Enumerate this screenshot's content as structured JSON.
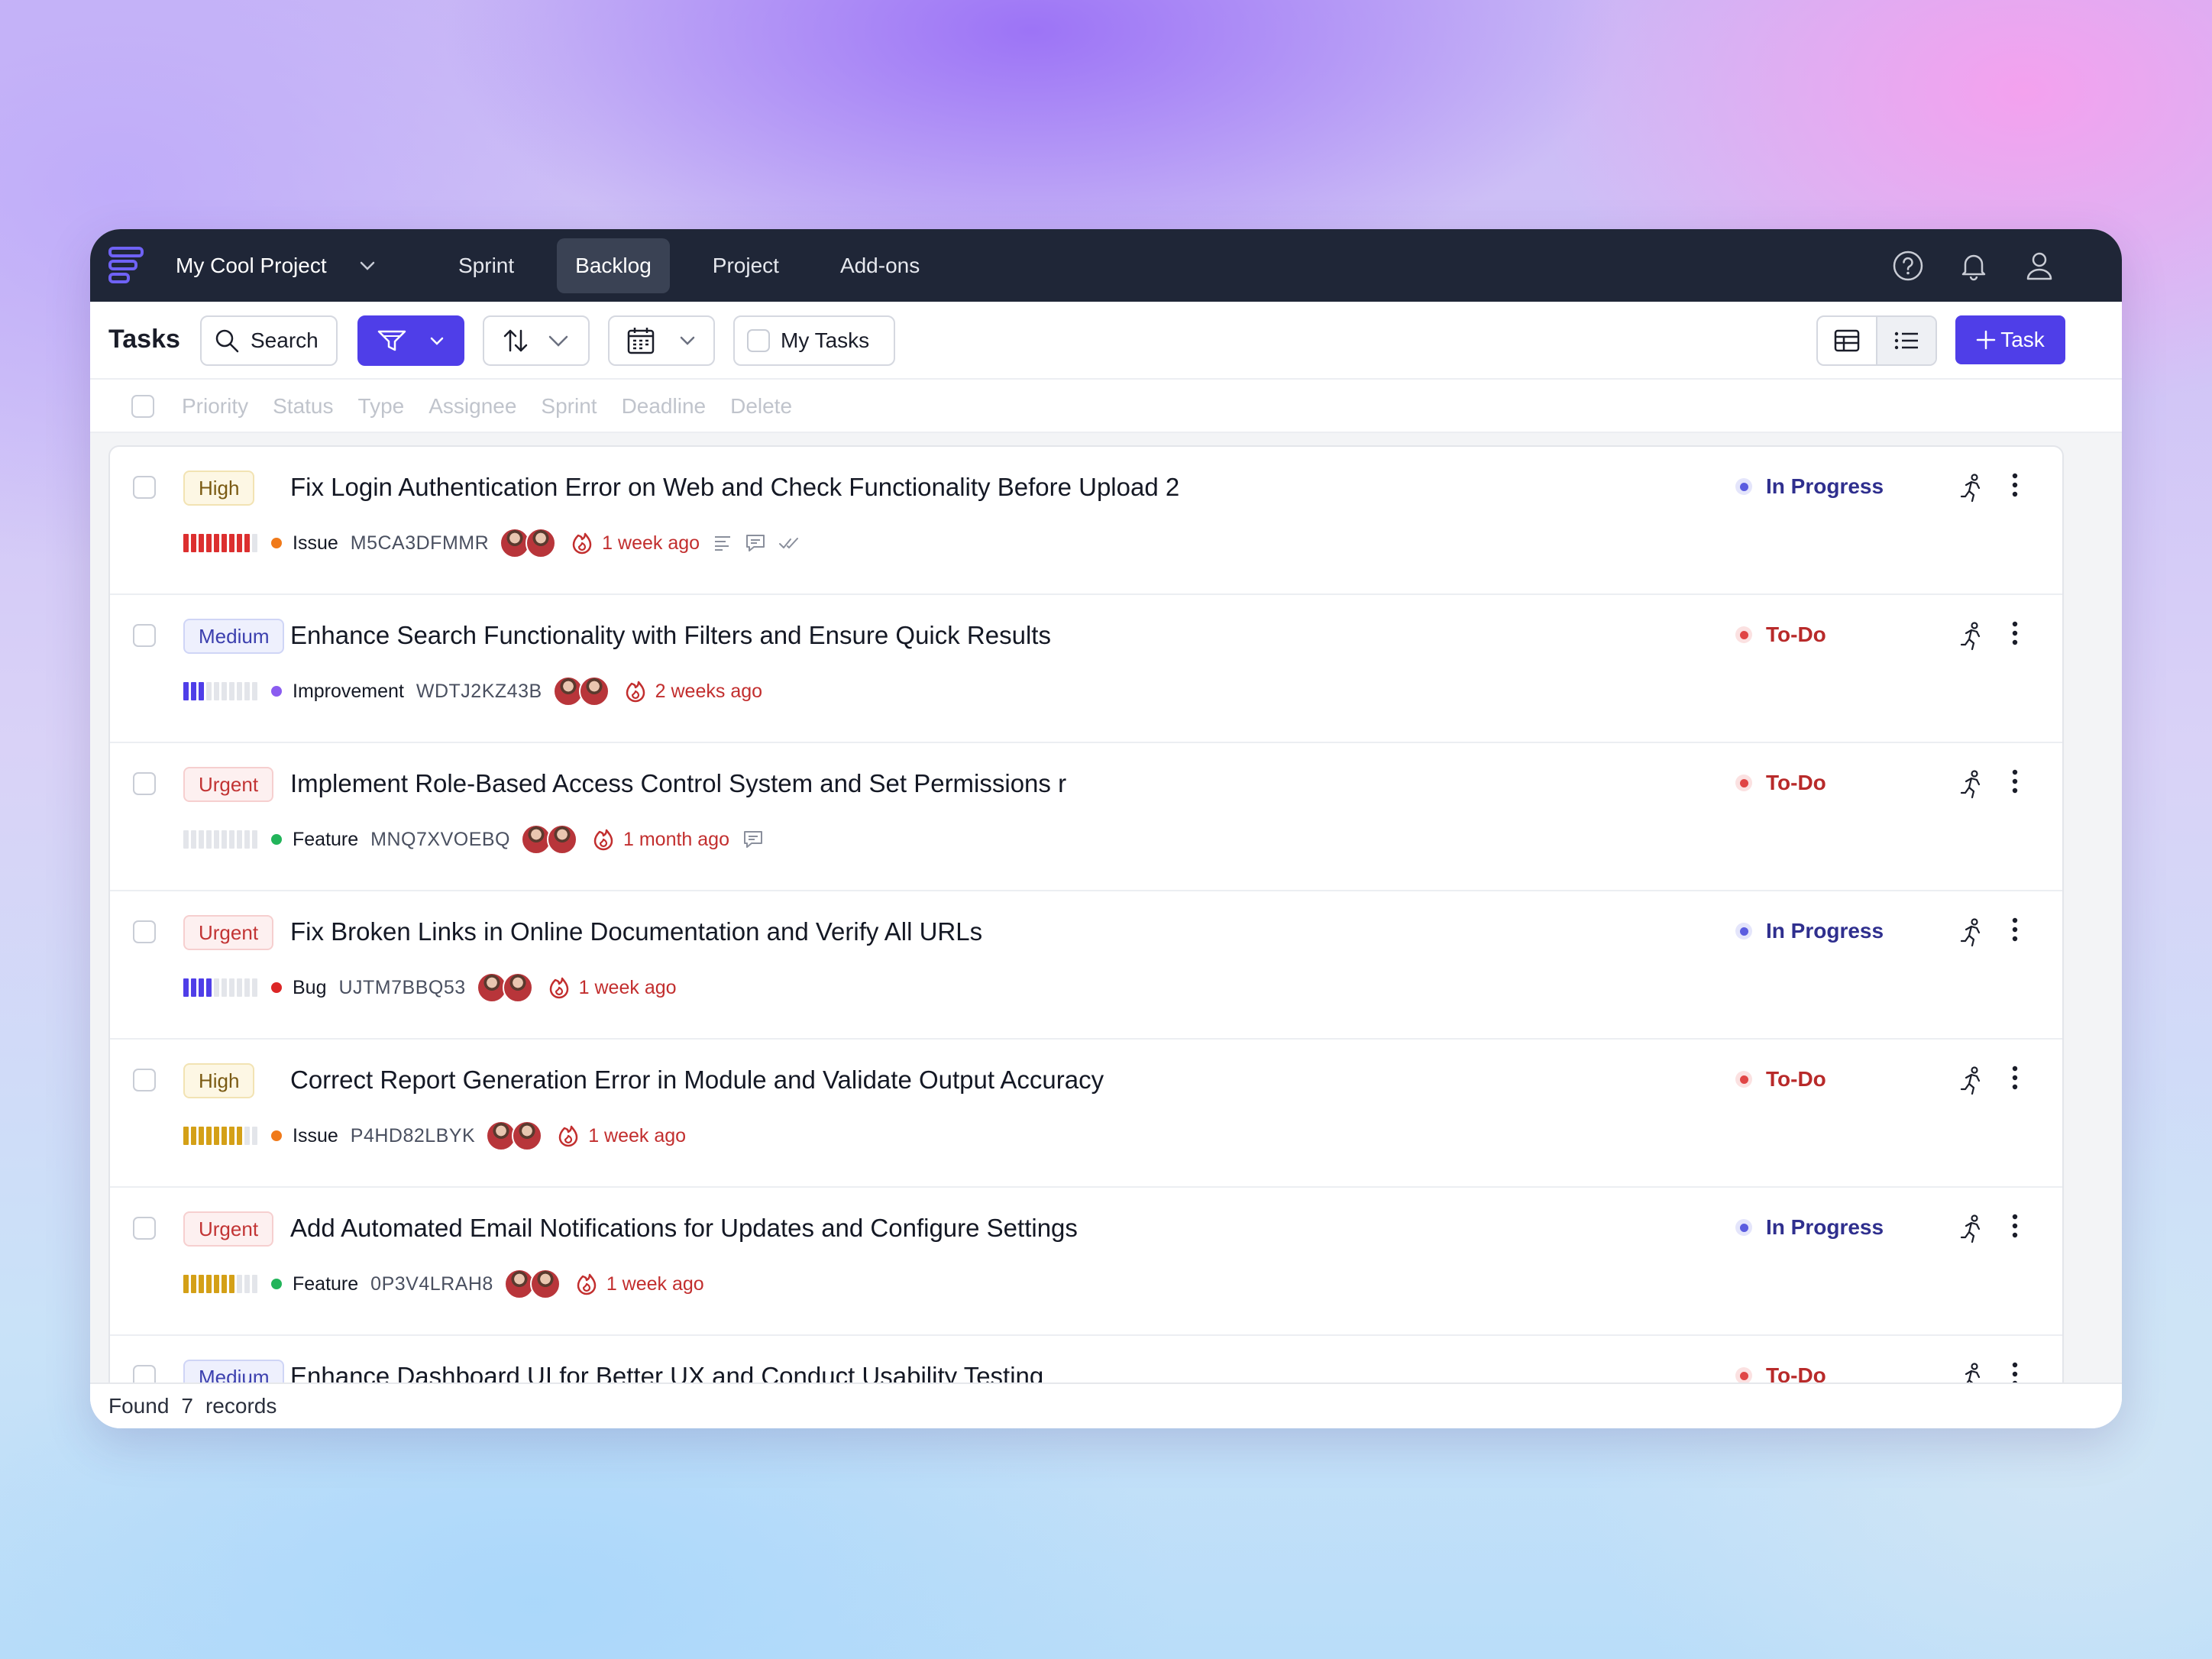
{
  "nav": {
    "project_name": "My Cool Project",
    "tabs": [
      {
        "label": "Sprint",
        "active": false
      },
      {
        "label": "Backlog",
        "active": true
      },
      {
        "label": "Project",
        "active": false
      },
      {
        "label": "Add-ons",
        "active": false
      }
    ],
    "icons": [
      "help-icon",
      "bell-icon",
      "user-icon"
    ]
  },
  "toolbar": {
    "title": "Tasks",
    "search_label": "Search",
    "my_tasks_label": "My Tasks",
    "add_task_label": "Task",
    "view_mode": "list",
    "accent": "#4f3ee8"
  },
  "bulk_actions": [
    "Priority",
    "Status",
    "Type",
    "Assignee",
    "Sprint",
    "Deadline",
    "Delete"
  ],
  "tasks": [
    {
      "priority": "High",
      "title": "Fix Login Authentication Error on Web and Check Functionality Before Upload 2",
      "progress_segments": 9,
      "progress_color": "#dc2f2f",
      "type": "Issue",
      "type_color": "#f07a1a",
      "id": "M5CA3DFMMR",
      "due": "1 week ago",
      "status": "In Progress",
      "icons": [
        "description-icon",
        "comment-icon",
        "checklist-icon"
      ]
    },
    {
      "priority": "Medium",
      "title": "Enhance Search Functionality with Filters and Ensure Quick Results",
      "progress_segments": 3,
      "progress_color": "#4f3ee8",
      "type": "Improvement",
      "type_color": "#8a5cf0",
      "id": "WDTJ2KZ43B",
      "due": "2 weeks ago",
      "status": "To-Do",
      "icons": []
    },
    {
      "priority": "Urgent",
      "title": "Implement Role-Based Access Control System and Set Permissions r",
      "progress_segments": 0,
      "progress_color": "#e3e5ea",
      "type": "Feature",
      "type_color": "#22b45a",
      "id": "MNQ7XVOEBQ",
      "due": "1 month ago",
      "status": "To-Do",
      "icons": [
        "comment-icon"
      ]
    },
    {
      "priority": "Urgent",
      "title": "Fix Broken Links in Online Documentation and Verify All URLs",
      "progress_segments": 4,
      "progress_color": "#4f3ee8",
      "type": "Bug",
      "type_color": "#dc2626",
      "id": "UJTM7BBQ53",
      "due": "1 week ago",
      "status": "In Progress",
      "icons": []
    },
    {
      "priority": "High",
      "title": "Correct Report Generation Error in Module and Validate Output Accuracy",
      "progress_segments": 8,
      "progress_color": "#d4a017",
      "type": "Issue",
      "type_color": "#f07a1a",
      "id": "P4HD82LBYK",
      "due": "1 week ago",
      "status": "To-Do",
      "icons": []
    },
    {
      "priority": "Urgent",
      "title": "Add Automated Email Notifications for Updates and Configure Settings",
      "progress_segments": 7,
      "progress_color": "#d4a017",
      "type": "Feature",
      "type_color": "#22b45a",
      "id": "0P3V4LRAH8",
      "due": "1 week ago",
      "status": "In Progress",
      "icons": []
    },
    {
      "priority": "Medium",
      "title": "Enhance Dashboard UI for Better UX and Conduct Usability Testing",
      "progress_segments": 0,
      "progress_color": "#e3e5ea",
      "type": "",
      "type_color": "#e3e5ea",
      "id": "",
      "due": "",
      "status": "To-Do",
      "icons": []
    }
  ],
  "footer": {
    "found_label": "Found",
    "count": "7",
    "records_label": "records"
  }
}
